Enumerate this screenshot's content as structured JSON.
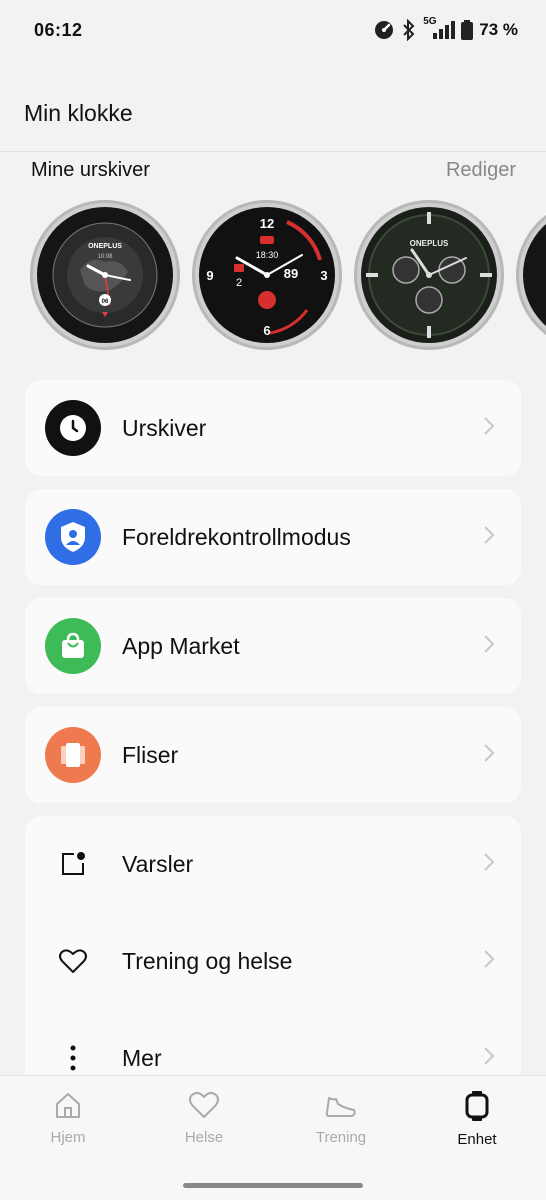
{
  "status": {
    "time": "06:12",
    "network": "5G",
    "battery": "73 %"
  },
  "header": {
    "title": "Min klokke"
  },
  "watchfaces": {
    "section_title": "Mine urskiver",
    "edit_label": "Rediger",
    "faces": [
      {
        "brand": "ONEPLUS",
        "time": "10:08",
        "date": "06"
      },
      {
        "time": "18:30",
        "value_left": "2",
        "value_right": "89"
      },
      {
        "brand": "ONEPLUS"
      }
    ]
  },
  "menu": {
    "watch_faces": "Urskiver",
    "parental": "Foreldrekontrollmodus",
    "app_market": "App Market",
    "tiles": "Fliser",
    "notifications": "Varsler",
    "training": "Trening og helse",
    "more": "Mer"
  },
  "nav": {
    "items": [
      {
        "label": "Hjem"
      },
      {
        "label": "Helse"
      },
      {
        "label": "Trening"
      },
      {
        "label": "Enhet"
      }
    ]
  },
  "colors": {
    "parental": "#2f6ee5",
    "app_market": "#3dbb57",
    "tiles": "#ef7a50"
  }
}
